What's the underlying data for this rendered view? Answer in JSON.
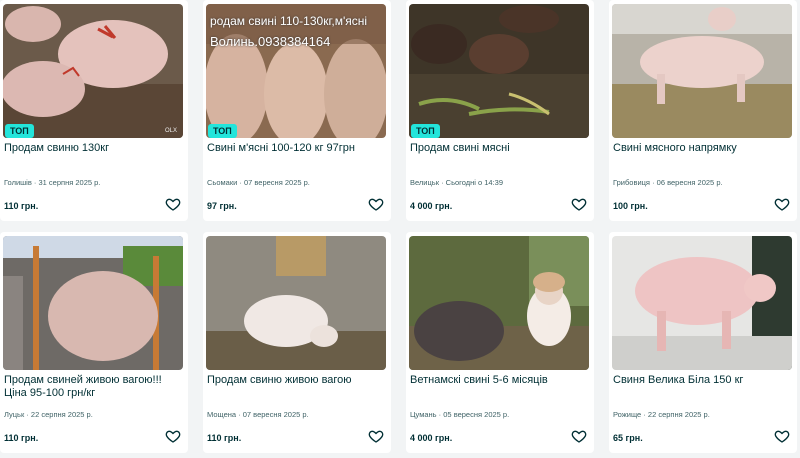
{
  "colors": {
    "badge_bg": "#23e5db",
    "text": "#002f34",
    "meta_text": "#406367",
    "page_bg": "#f2f4f5"
  },
  "listings": [
    {
      "title": "Продам свиню 130кг",
      "location": "Голишів",
      "date": "31 серпня 2025 р.",
      "price": "110 грн.",
      "badge": "ТОП",
      "watermark": "OLX"
    },
    {
      "title": "Свині м'ясні 100-120 кг 97грн",
      "location": "Сьомаки",
      "date": "07 вересня 2025 р.",
      "price": "97 грн.",
      "badge": "ТОП",
      "photo_text_1": "родам свині 110-130кг,м'ясні",
      "photo_text_2": "Волинь.0938384164"
    },
    {
      "title": "Продам свині мясні",
      "location": "Велицьк",
      "date": "Сьогодні о 14:39",
      "price": "4 000 грн.",
      "badge": "ТОП"
    },
    {
      "title": "Свині мясного напрямку",
      "location": "Грибовиця",
      "date": "06 вересня 2025 р.",
      "price": "100 грн."
    },
    {
      "title": "Продам свиней живою вагою!!! Ціна 95-100 грн/кг",
      "location": "Луцьк",
      "date": "22 серпня 2025 р.",
      "price": "110 грн."
    },
    {
      "title": "Продам свиню живою вагою",
      "location": "Мощена",
      "date": "07 вересня 2025 р.",
      "price": "110 грн."
    },
    {
      "title": "Ветнамскі свині 5-6 місяців",
      "location": "Цумань",
      "date": "05 вересня 2025 р.",
      "price": "4 000 грн."
    },
    {
      "title": "Свиня Велика Біла 150 кг",
      "location": "Рожище",
      "date": "22 серпня 2025 р.",
      "price": "65 грн."
    }
  ],
  "icons": {
    "favorite": "heart-outline-icon"
  }
}
